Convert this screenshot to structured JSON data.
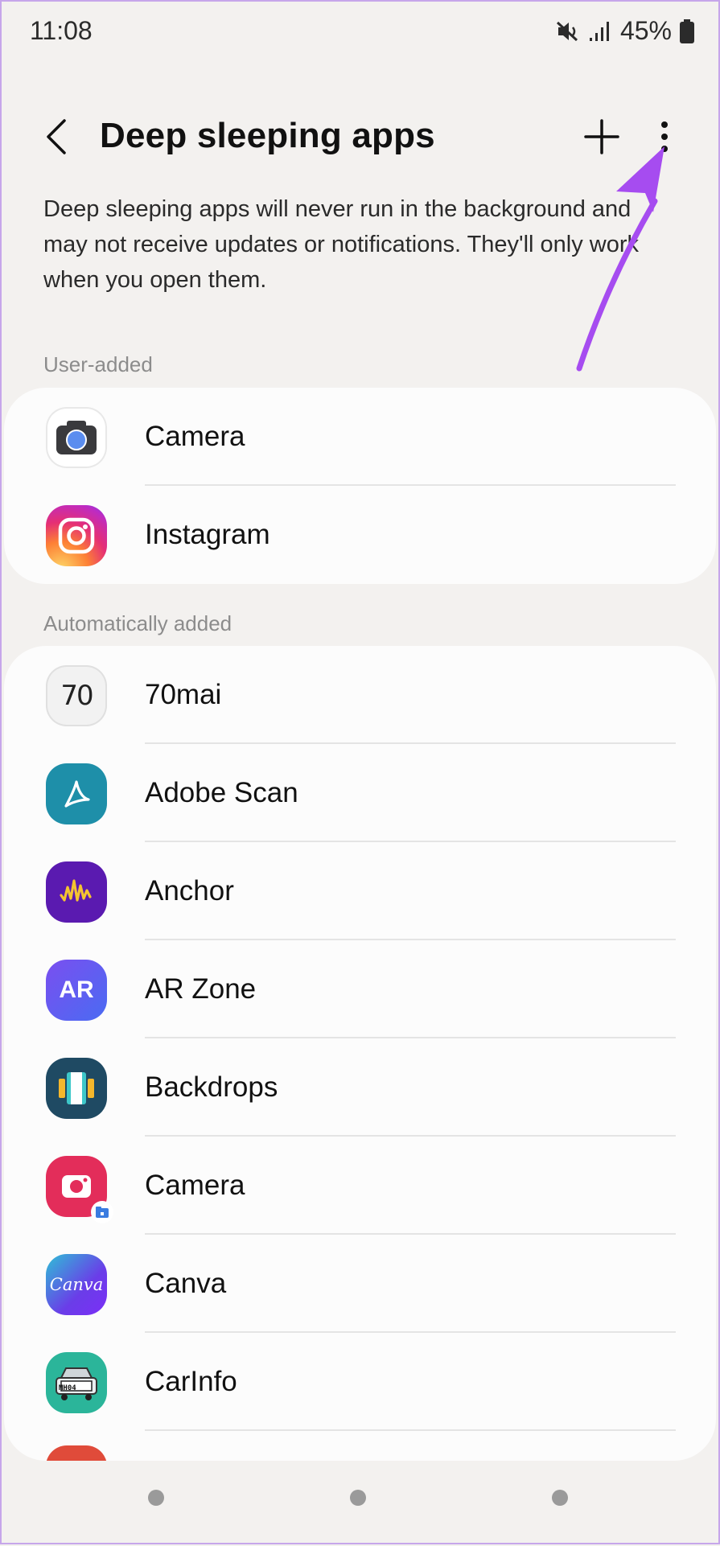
{
  "status_bar": {
    "time": "11:08",
    "battery": "45%",
    "icons": [
      "mute-icon",
      "signal-icon",
      "battery-icon"
    ]
  },
  "header": {
    "title": "Deep sleeping apps",
    "icons": [
      "back-icon",
      "plus-icon",
      "more-vert-icon"
    ]
  },
  "description": "Deep sleeping apps will never run in the background and may not receive updates or notifications. They'll only work when you open them.",
  "sections": {
    "user_added": {
      "label": "User-added",
      "apps": [
        {
          "name": "Camera",
          "icon": "camera-icon"
        },
        {
          "name": "Instagram",
          "icon": "instagram-icon"
        }
      ]
    },
    "auto_added": {
      "label": "Automatically added",
      "apps": [
        {
          "name": "70mai",
          "icon": "70mai-icon"
        },
        {
          "name": "Adobe Scan",
          "icon": "adobe-scan-icon"
        },
        {
          "name": "Anchor",
          "icon": "anchor-icon"
        },
        {
          "name": "AR Zone",
          "icon": "ar-zone-icon"
        },
        {
          "name": "Backdrops",
          "icon": "backdrops-icon"
        },
        {
          "name": "Camera",
          "icon": "camera-secure-icon"
        },
        {
          "name": "Canva",
          "icon": "canva-icon"
        },
        {
          "name": "CarInfo",
          "icon": "carinfo-icon"
        }
      ]
    }
  },
  "icon_text": {
    "seventy": "70",
    "ar": "AR",
    "canva": "Canva",
    "mh": "MH04"
  },
  "colors": {
    "accent_arrow": "#a64cf0",
    "background": "#f3f1ef",
    "card": "#fcfcfc"
  }
}
